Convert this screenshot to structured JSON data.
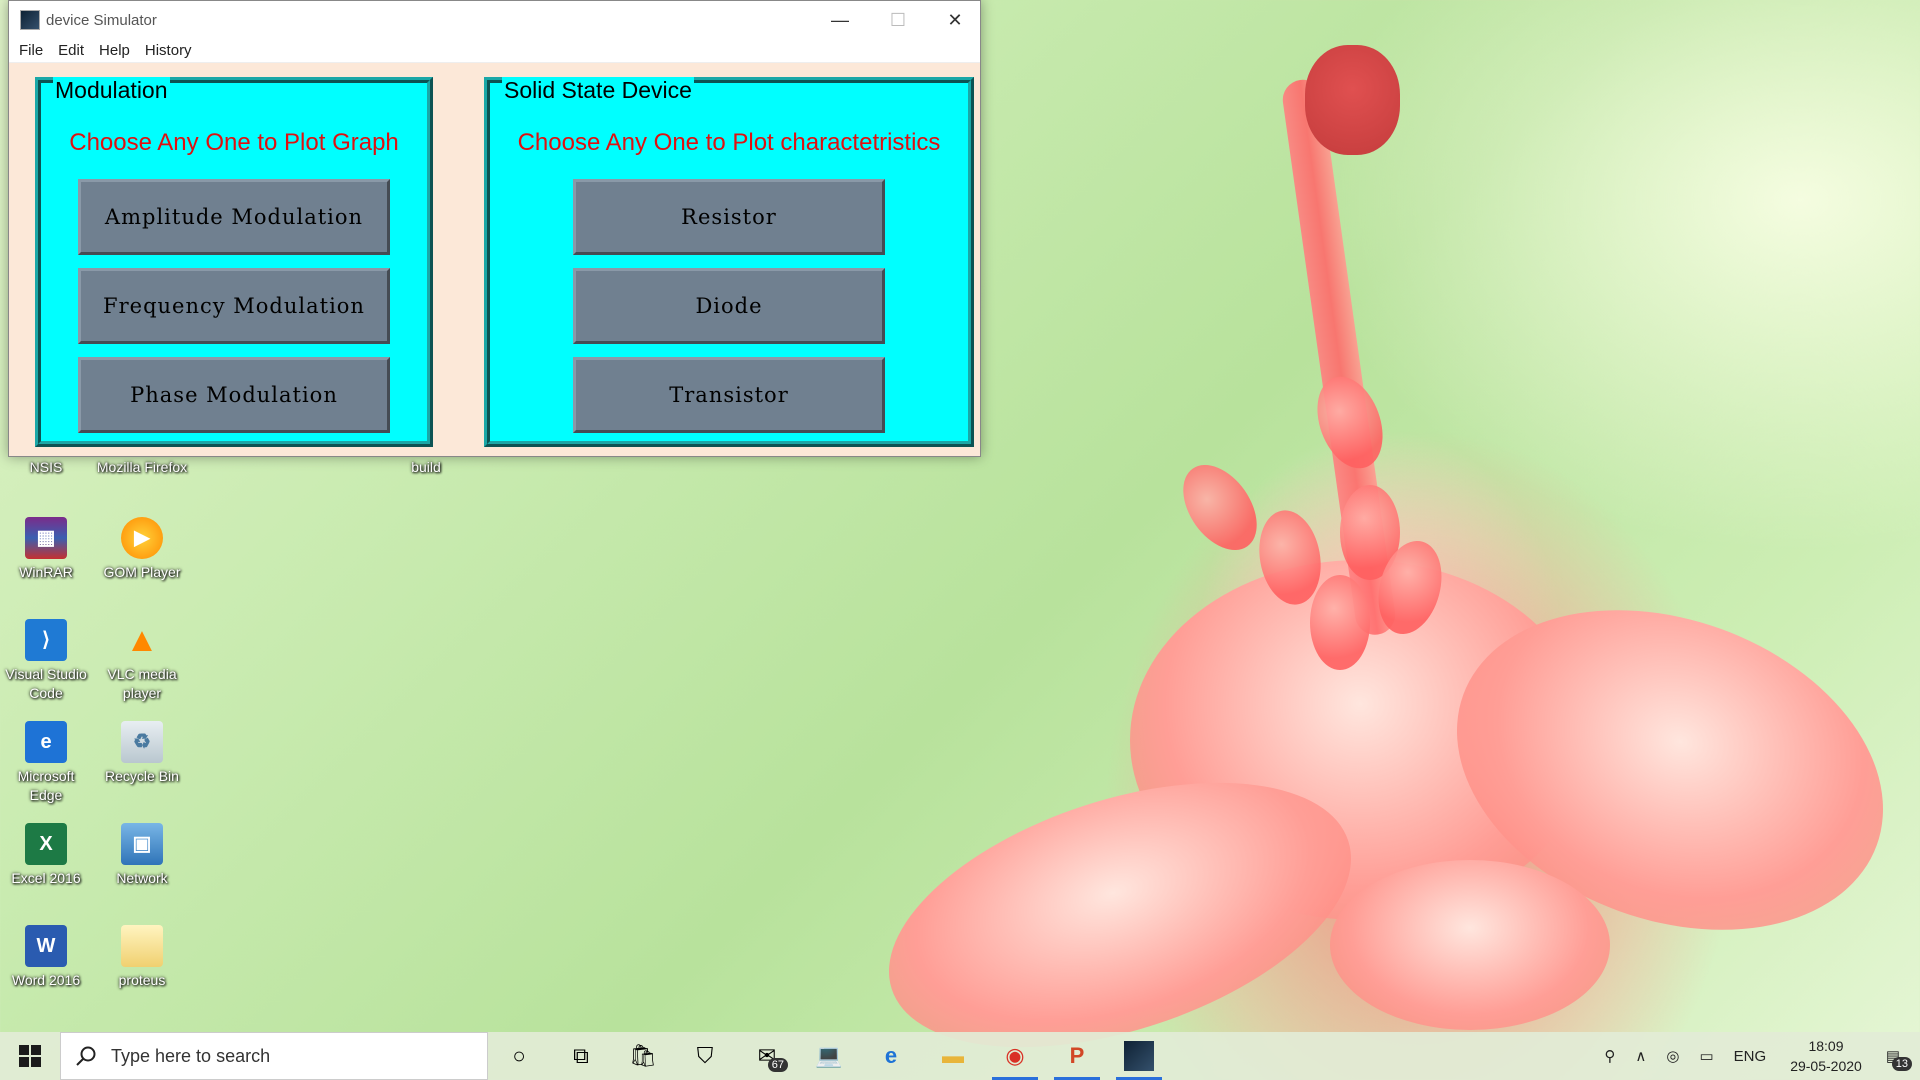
{
  "window": {
    "title": "device Simulator",
    "minimize_glyph": "—",
    "maximize_glyph": "☐",
    "close_glyph": "✕"
  },
  "menu": [
    "File",
    "Edit",
    "Help",
    "History"
  ],
  "modulation": {
    "title": "Modulation",
    "subtitle": "Choose Any One to Plot Graph",
    "buttons": [
      "Amplitude Modulation",
      "Frequency Modulation",
      "Phase Modulation"
    ]
  },
  "solid_state": {
    "title": "Solid State Device",
    "subtitle": "Choose Any One to Plot charactetristics",
    "buttons": [
      "Resistor",
      "Diode",
      "Transistor"
    ]
  },
  "desktop_icons": {
    "nsis": "NSIS",
    "firefox": "Mozilla Firefox",
    "build": "build",
    "winrar": "WinRAR",
    "gom": "GOM Player",
    "vscode": "Visual Studio Code",
    "vlc": "VLC media player",
    "edge": "Microsoft Edge",
    "recycle": "Recycle Bin",
    "excel": "Excel 2016",
    "network": "Network",
    "word": "Word 2016",
    "proteus": "proteus"
  },
  "taskbar": {
    "search_placeholder": "Type here to search",
    "mail_badge": "67",
    "language": "ENG",
    "time": "18:09",
    "date": "29-05-2020",
    "notification_count": "13"
  },
  "colors": {
    "frame_bg": "#00ffff",
    "button_bg": "#708090",
    "subtitle": "#e01010",
    "window_bg": "#fce8d8"
  }
}
